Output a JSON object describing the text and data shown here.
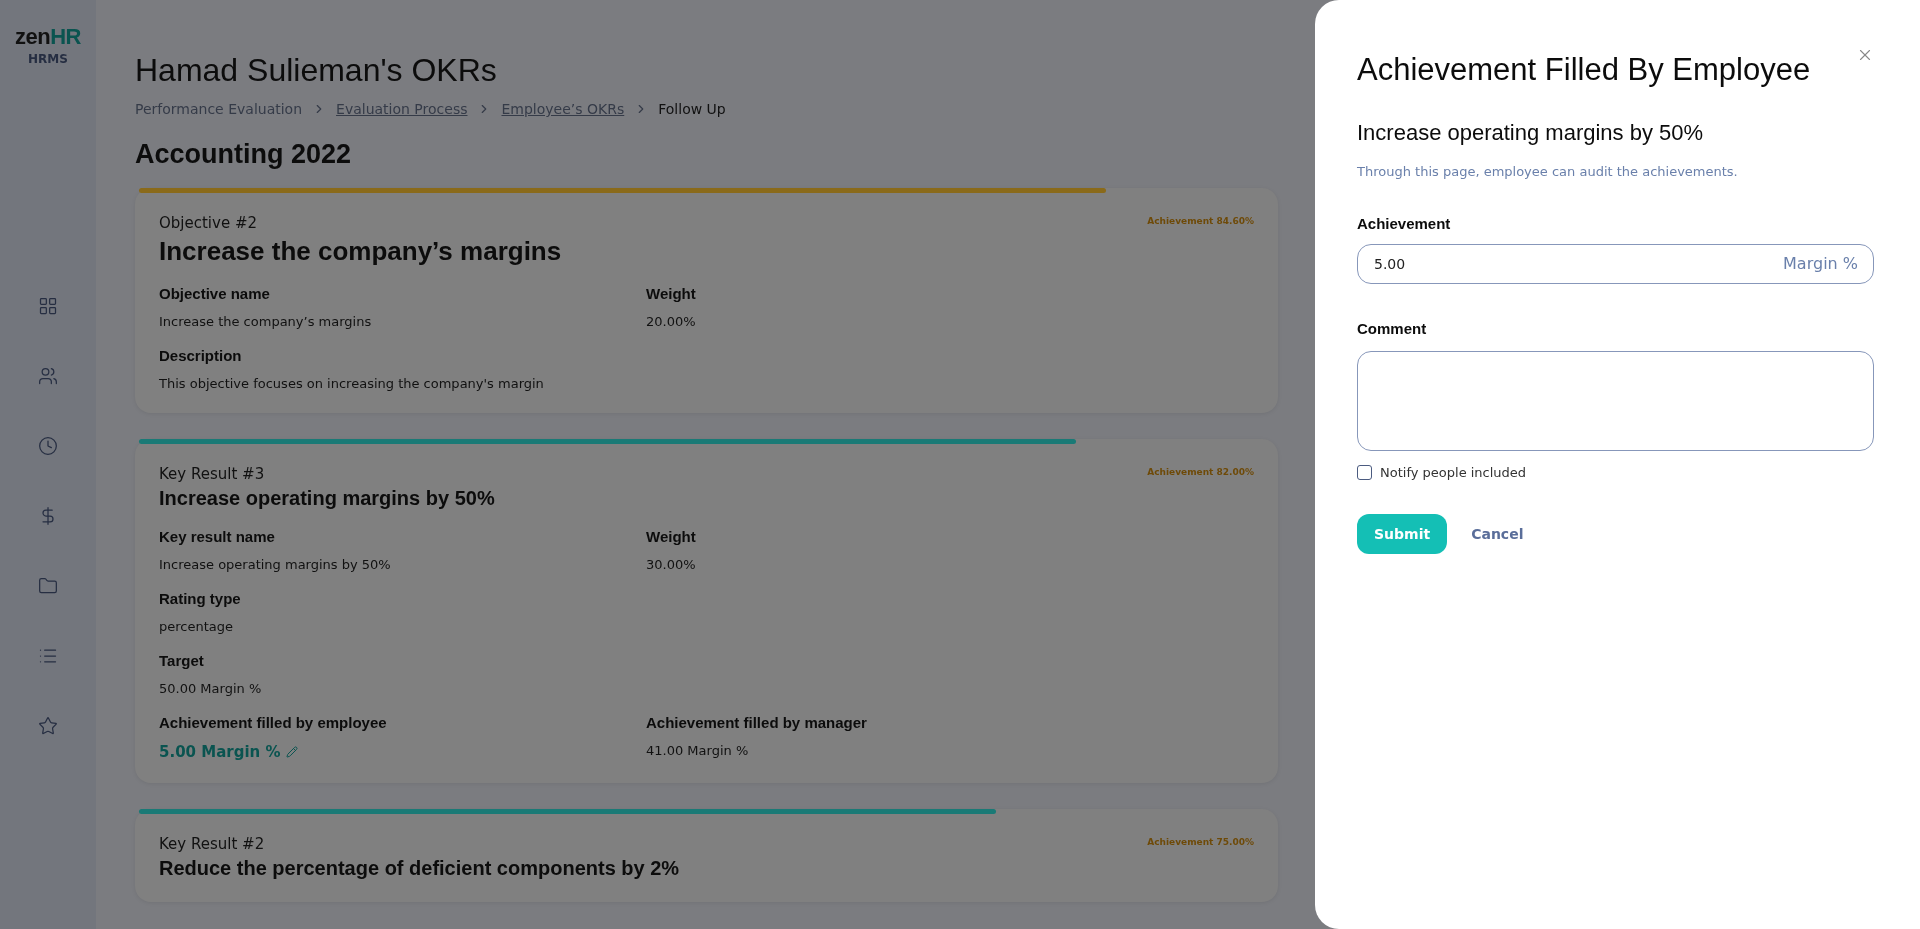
{
  "sidebar": {
    "logo": {
      "first": "zen",
      "second": "HR"
    },
    "product": "HRMS",
    "nav_items": [
      {
        "kind": "grid"
      },
      {
        "kind": "people"
      },
      {
        "kind": "clock"
      },
      {
        "kind": "dollar"
      },
      {
        "kind": "folder"
      },
      {
        "kind": "list"
      },
      {
        "kind": "star"
      }
    ]
  },
  "page": {
    "title": "Hamad Sulieman's OKRs",
    "breadcrumb": [
      {
        "label": "Performance Evaluation",
        "link": false
      },
      {
        "label": "Evaluation Process",
        "link": true
      },
      {
        "label": "Employee’s OKRs",
        "link": true
      },
      {
        "label": "Follow Up",
        "link": false
      }
    ],
    "section_title": "Accounting 2022",
    "cards": [
      {
        "kind": "objective",
        "label": "Objective #2",
        "title": "Increase the company’s margins",
        "achievement": "Achievement 84.60%",
        "level": 0.846,
        "color": "#8a6a1a",
        "rows": [
          [
            {
              "label": "Objective name",
              "value": "Increase the company’s margins"
            },
            {
              "label": "Weight",
              "value": "20.00%"
            }
          ],
          [
            {
              "label": "Description",
              "value": "This objective focuses on increasing the company's margin"
            }
          ]
        ]
      },
      {
        "kind": "key_result",
        "label": "Key Result #3",
        "title": "Increase operating margins by 50%",
        "achievement": "Achievement 82.00%",
        "level": 0.82,
        "color": "#1a7a76",
        "rows": [
          [
            {
              "label": "Key result name",
              "value": "Increase operating margins by 50%"
            },
            {
              "label": "Weight",
              "value": "30.00%"
            }
          ],
          [
            {
              "label": "Rating type",
              "value": "percentage"
            }
          ],
          [
            {
              "label": "Target",
              "value": "50.00 Margin %"
            }
          ],
          [
            {
              "label": "Achievement filled by employee",
              "value": "5.00 Margin %",
              "editable": true
            },
            {
              "label": "Achievement filled by manager",
              "value": "41.00 Margin %"
            }
          ]
        ]
      },
      {
        "kind": "key_result",
        "label": "Key Result #2",
        "title": "Reduce the percentage of deficient components by 2%",
        "achievement": "Achievement 75.00%",
        "level": 0.75,
        "color": "#1a7a76"
      }
    ]
  },
  "drawer": {
    "title": "Achievement Filled By Employee",
    "subtitle": "Increase operating margins by 50%",
    "description": "Through this page, employee can audit the achievements.",
    "achievement": {
      "label": "Achievement",
      "value": "5.00",
      "unit": "Margin %"
    },
    "comment": {
      "label": "Comment"
    },
    "notify": {
      "label": "Notify people included",
      "checked": false
    },
    "buttons": {
      "submit": "Submit",
      "cancel": "Cancel"
    }
  }
}
